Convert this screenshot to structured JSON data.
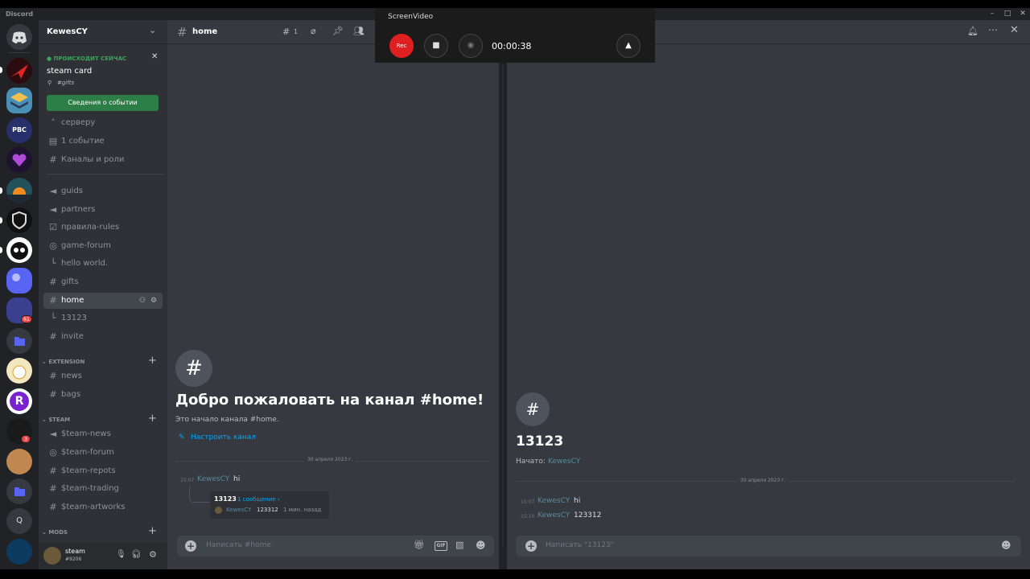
{
  "app": {
    "name": "Discord"
  },
  "window_controls": {
    "minimize": "–",
    "maximize": "□",
    "close": "✕"
  },
  "guild_badges": {
    "b1": "61",
    "b2": "3"
  },
  "guild_letters": {
    "r": "R",
    "q": "Q",
    "pbc": "PBC"
  },
  "server": {
    "name": "KewesCY"
  },
  "event": {
    "status": "● ПРОИСХОДИТ СЕЙЧАС",
    "title": "steam card",
    "channel": "#gifts",
    "button": "Сведения о событии"
  },
  "channels": {
    "server_guide": "серверу",
    "events": "1 событие",
    "roles": "Каналы и роли",
    "guids": "guids",
    "partners": "partners",
    "rules": "правила-rules",
    "game_forum": "game-forum",
    "hello_world": "hello world.",
    "gifts": "gifts",
    "home": "home",
    "thread_13123": "13123",
    "invite": "invite"
  },
  "categories": {
    "extension": "EXTENSION",
    "team": "$TEAM",
    "mods": "MODS"
  },
  "extension": {
    "news": "news",
    "bags": "bags"
  },
  "team": {
    "team_news": "$team-news",
    "team_forum": "$team-forum",
    "team_repots": "$team-repots",
    "team_trading": "$team-trading",
    "team_artworks": "$team-artworks"
  },
  "user": {
    "name": "steam",
    "tag": "#9206"
  },
  "main": {
    "channel_name": "home",
    "threads_count": "1",
    "welcome_title": "Добро пожаловать на канал #home!",
    "welcome_sub": "Это начало канала #home.",
    "edit_channel": "Настроить канал",
    "date_divider": "30 апреля 2023 г.",
    "message": {
      "time": "15:07",
      "author": "KewesCY",
      "text": "hi"
    },
    "thread_preview": {
      "name": "13123",
      "count": "1 сообщение ›",
      "author": "KewesCY",
      "text": "123312",
      "ago": "1 мин. назад"
    },
    "input_placeholder": "Написать #home"
  },
  "thread": {
    "title": "13123",
    "started_label": "Начато:",
    "started_by": "KewesCY",
    "date_divider": "30 апреля 2023 г.",
    "messages": [
      {
        "time": "15:07",
        "author": "KewesCY",
        "text": "hi"
      },
      {
        "time": "15:10",
        "author": "KewesCY",
        "text": "123312"
      }
    ],
    "input_placeholder": "Написать \"13123\""
  },
  "recorder": {
    "title": "ScreenVideo",
    "rec_label": "Rec",
    "timer": "00:00:38"
  },
  "colors": {
    "accent": "#00a8fc",
    "green": "#2d7d46",
    "red": "#e02020",
    "bg": "#36393f"
  }
}
